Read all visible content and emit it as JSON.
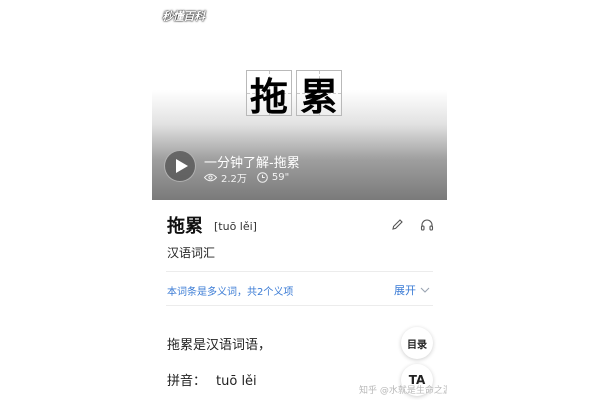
{
  "header": {
    "logo_text": "秒懂百科",
    "char_1": "拖",
    "char_2": "累"
  },
  "video": {
    "title": "一分钟了解-拖累",
    "views": "2.2万",
    "duration": "59\""
  },
  "entry": {
    "title": "拖累",
    "pinyin": "[tuō lěi]",
    "category": "汉语词汇",
    "polysemy_note": "本词条是多义词，共2个义项",
    "expand_label": "展开"
  },
  "content": {
    "paragraph_1": "拖累是汉语词语，",
    "pinyin_label": "拼音：",
    "pinyin_value": "tuō lěi"
  },
  "fab": {
    "toc_label": "目录",
    "text_size_label": "TA"
  },
  "watermark": "知乎 @水就是生命之源"
}
